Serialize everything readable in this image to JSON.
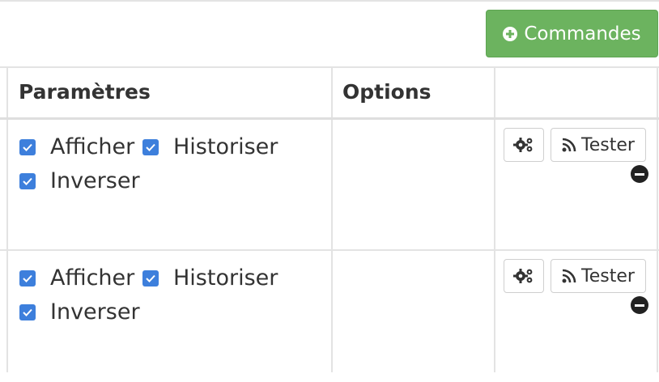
{
  "toolbar": {
    "commandes_label": "Commandes",
    "commandes_icon": "plus-circle-icon",
    "accent": "#6cb35f"
  },
  "table": {
    "headers": {
      "parametres": "Paramètres",
      "options": "Options",
      "actions": ""
    },
    "rows": [
      {
        "afficher": "Afficher",
        "historiser": "Historiser",
        "inverser": "Inverser",
        "afficher_checked": true,
        "historiser_checked": true,
        "inverser_checked": true,
        "tester_label": "Tester"
      },
      {
        "afficher": "Afficher",
        "historiser": "Historiser",
        "inverser": "Inverser",
        "afficher_checked": true,
        "historiser_checked": true,
        "inverser_checked": true,
        "tester_label": "Tester"
      }
    ]
  },
  "colors": {
    "checkbox": "#3d7fdc",
    "border": "#e3e3e3"
  }
}
